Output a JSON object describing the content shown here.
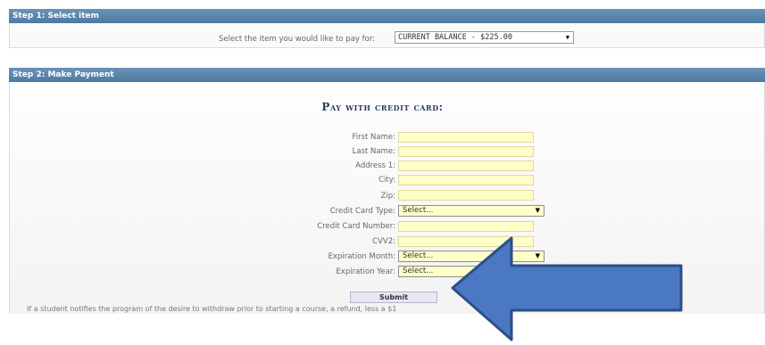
{
  "step1": {
    "header": "Step 1: Select item",
    "label": "Select the item you would like to pay for:",
    "selected": "CURRENT BALANCE - $225.00"
  },
  "step2": {
    "header": "Step 2: Make Payment",
    "title": "Pay with credit card:",
    "fields": {
      "first_name": "First Name:",
      "last_name": "Last Name:",
      "address1": "Address 1:",
      "city": "City:",
      "zip": "Zip:",
      "card_type": "Credit Card Type:",
      "card_number": "Credit Card Number:",
      "cvv2": "CVV2:",
      "exp_month": "Expiration Month:",
      "exp_year": "Expiration Year:"
    },
    "select_placeholder": "Select...",
    "submit": "Submit",
    "footer": "If a student notifies the program of the desire to withdraw prior to starting a course, a refund, less a $1"
  },
  "colors": {
    "header_bg": "#4f7fa6",
    "input_bg": "#ffffc8",
    "arrow_fill": "#4a78c2",
    "arrow_stroke": "#2c4f86"
  },
  "icons": {
    "dropdown": "chevron-down-icon",
    "overlay": "arrow-left-icon"
  }
}
